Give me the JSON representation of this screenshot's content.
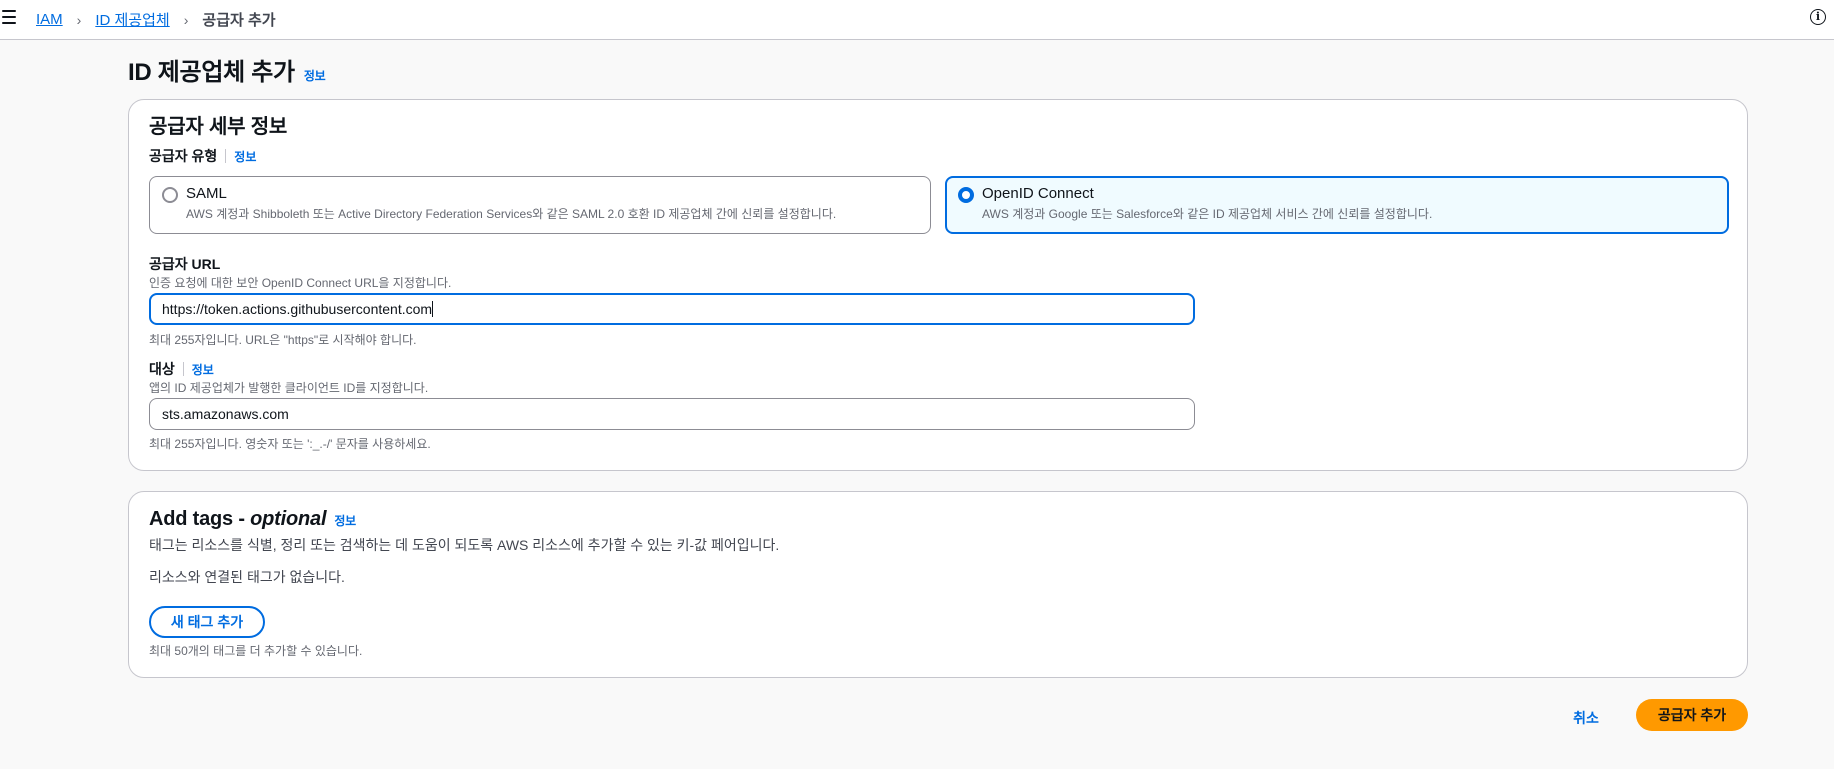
{
  "breadcrumb": {
    "items": [
      "IAM",
      "ID 제공업체"
    ],
    "current": "공급자 추가",
    "separator": "›"
  },
  "header": {
    "info_icon_label": "i"
  },
  "page": {
    "title": "ID 제공업체 추가",
    "info_link": "정보"
  },
  "provider_details": {
    "heading": "공급자 세부 정보",
    "provider_type_label": "공급자 유형",
    "provider_type_info": "정보",
    "options": [
      {
        "title": "SAML",
        "description": "AWS 계정과 Shibboleth 또는 Active Directory Federation Services와 같은 SAML 2.0 호환 ID 제공업체 간에 신뢰를 설정합니다.",
        "selected": false
      },
      {
        "title": "OpenID Connect",
        "description": "AWS 계정과 Google 또는 Salesforce와 같은 ID 제공업체 서비스 간에 신뢰를 설정합니다.",
        "selected": true
      }
    ],
    "provider_url": {
      "label": "공급자 URL",
      "description": "인증 요청에 대한 보안 OpenID Connect URL을 지정합니다.",
      "value": "https://token.actions.githubusercontent.com",
      "constraint": "최대 255자입니다. URL은 \"https\"로 시작해야 합니다."
    },
    "audience": {
      "label": "대상",
      "info": "정보",
      "description": "앱의 ID 제공업체가 발행한 클라이언트 ID를 지정합니다.",
      "value": "sts.amazonaws.com",
      "constraint": "최대 255자입니다. 영숫자 또는 ':_.-/' 문자를 사용하세요."
    }
  },
  "tags": {
    "heading_main": "Add tags - ",
    "heading_optional": "optional",
    "info": "정보",
    "description": "태그는 리소스를 식별, 정리 또는 검색하는 데 도움이 되도록 AWS 리소스에 추가할 수 있는 키-값 페어입니다.",
    "empty_message": "리소스와 연결된 태그가 없습니다.",
    "add_button": "새 태그 추가",
    "limit_note": "최대 50개의 태그를 더 추가할 수 있습니다."
  },
  "actions": {
    "cancel": "취소",
    "submit": "공급자 추가"
  },
  "colors": {
    "accent": "#006ce0",
    "primary_button": "#ff9900",
    "selected_tile_bg": "#f0fbff"
  }
}
